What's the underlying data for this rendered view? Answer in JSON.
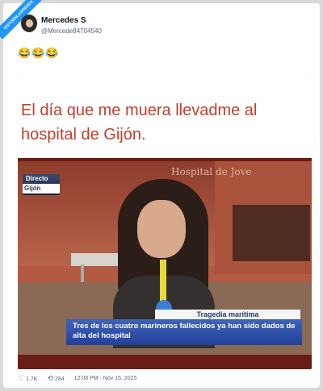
{
  "account": {
    "name": "Mercedes S",
    "handle": "@Mercede84704540"
  },
  "tweet": {
    "text": "😂😂😂"
  },
  "badge": {
    "label": "VISTOENLASREDES"
  },
  "media": {
    "caption": "El día que me muera llevadme al hospital de Gijón.",
    "live_label": "Directo",
    "live_location": "Gijón",
    "wall_sign": "Hospital de Jove",
    "lower_third_title": "Tragedia marítima",
    "lower_third_text": "Tres de los cuatro marineros fallecidos ya han sido dados de alta del hospital"
  },
  "stats": {
    "likes": "1.7K",
    "retweets": "284",
    "timestamp": "12:08 PM - Nov 15, 2025"
  },
  "colors": {
    "caption": "#c43d2b",
    "lower_third": "#2f4fa8"
  }
}
